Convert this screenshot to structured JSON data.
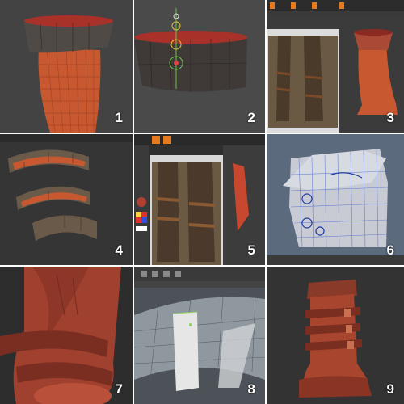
{
  "panels": [
    {
      "number": "1"
    },
    {
      "number": "2"
    },
    {
      "number": "3"
    },
    {
      "number": "4"
    },
    {
      "number": "5"
    },
    {
      "number": "6"
    },
    {
      "number": "7"
    },
    {
      "number": "8"
    },
    {
      "number": "9"
    }
  ],
  "colors": {
    "leather": "#c8582f",
    "leather_dark": "#8a3a22",
    "cuff": "#4a4038",
    "cuff_inner": "#a8322a",
    "clay": "#a84a35",
    "wire_blue": "#3a5fd0",
    "maya_bg": "#5b6a7d",
    "zbrush_orange": "#e87a1e"
  },
  "icons": {
    "gizmo": "transform-gizmo-icon",
    "color_picker": "color-picker-icon"
  }
}
